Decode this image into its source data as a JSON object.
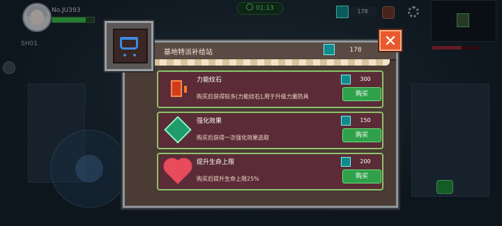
{
  "hud": {
    "player_name": "No.JU393",
    "zone_label": "SH01",
    "timer": "01:13",
    "gem_count": "178"
  },
  "shop": {
    "title": "基地特派补给站",
    "gem_balance": "178",
    "close_label": "✕",
    "items": [
      {
        "name": "力能纹石",
        "desc": "购买后获得较多[力能纹石],用于升级力量防具",
        "price": "300",
        "buy_label": "购买",
        "icon": "power-stone-icon"
      },
      {
        "name": "强化效果",
        "desc": "购买后获得一次强化效果选取",
        "price": "150",
        "buy_label": "购买",
        "icon": "enhance-gem-icon"
      },
      {
        "name": "提升生命上限",
        "desc": "购买后提升生命上限25%",
        "price": "200",
        "buy_label": "购买",
        "icon": "heart-icon"
      }
    ]
  },
  "colors": {
    "accent_green": "#2fa14a",
    "item_bg": "#5b2c37",
    "close_red": "#e85a2e",
    "gem_teal": "#0f8a8d"
  }
}
